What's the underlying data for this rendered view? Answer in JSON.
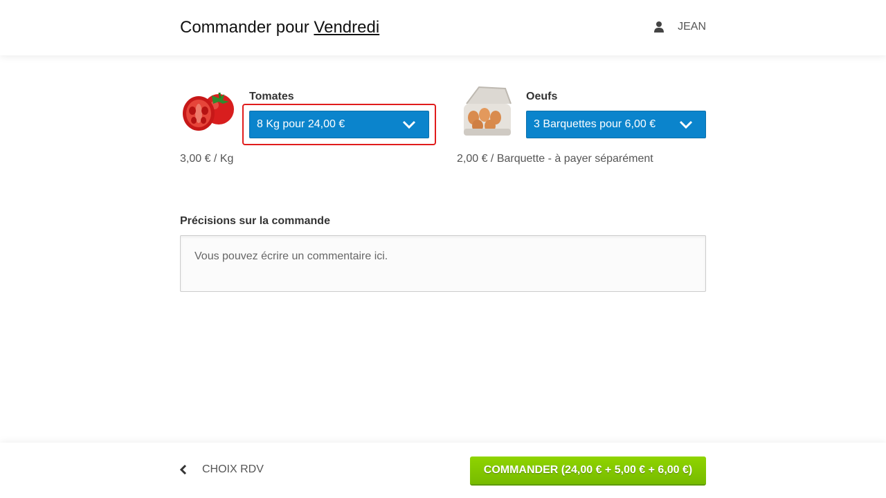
{
  "header": {
    "title_prefix": "Commander pour",
    "title_day": "Vendredi",
    "user_icon": "user-icon",
    "user_name": "JEAN"
  },
  "products": [
    {
      "name": "Tomates",
      "image": "tomato-image",
      "selected_option": "8 Kg pour 24,00 €",
      "unit_price": "3,00 € / Kg"
    },
    {
      "name": "Oeufs",
      "image": "eggs-carton-image",
      "selected_option": "3 Barquettes pour 6,00 €",
      "unit_price": "2,00 € / Barquette - à payer séparément"
    }
  ],
  "comment": {
    "label": "Précisions sur la commande",
    "placeholder": "Vous pouvez écrire un commentaire ici."
  },
  "footer": {
    "back_label": "CHOIX RDV",
    "order_button": "COMMANDER (24,00 € + 5,00 € + 6,00 €)"
  },
  "colors": {
    "select_blue": "#0b84cc",
    "order_green": "#7dc400",
    "highlight_red": "#e01b1b"
  }
}
